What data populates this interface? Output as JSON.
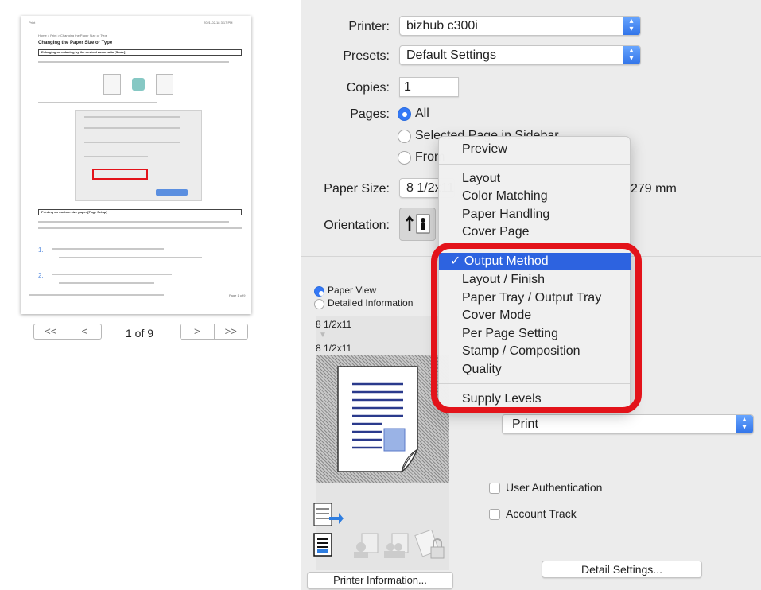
{
  "printer": {
    "label": "Printer:",
    "value": "bizhub c300i"
  },
  "presets": {
    "label": "Presets:",
    "value": "Default Settings"
  },
  "copies": {
    "label": "Copies:",
    "value": "1"
  },
  "pages": {
    "label": "Pages:",
    "all": "All",
    "selected": "Selected Page in Sidebar",
    "from": "From"
  },
  "paper_size": {
    "label": "Paper Size:",
    "value": "8 1/2x11",
    "dims": "279 mm"
  },
  "orientation": {
    "label": "Orientation:"
  },
  "page_nav": {
    "first": "<<",
    "prev": "<",
    "counter": "1 of 9",
    "next": ">",
    "last": ">>"
  },
  "view": {
    "paper_view": "Paper View",
    "detailed_info": "Detailed Information",
    "paper1": "8 1/2x11",
    "paper2": "8 1/2x11"
  },
  "menu": {
    "items": [
      "Preview",
      "Layout",
      "Color Matching",
      "Paper Handling",
      "Cover Page",
      "Output Method",
      "Layout / Finish",
      "Paper Tray / Output Tray",
      "Cover Mode",
      "Per Page Setting",
      "Stamp / Composition",
      "Quality",
      "Supply Levels"
    ],
    "selected": "Output Method",
    "check": "✓"
  },
  "output_method": {
    "value": "Print"
  },
  "checkboxes": {
    "user_auth": "User Authentication",
    "account_track": "Account Track"
  },
  "buttons": {
    "printer_info": "Printer Information...",
    "detail_settings": "Detail Settings..."
  },
  "colors": {
    "accent": "#2d63e0",
    "highlight": "#e3131a"
  }
}
